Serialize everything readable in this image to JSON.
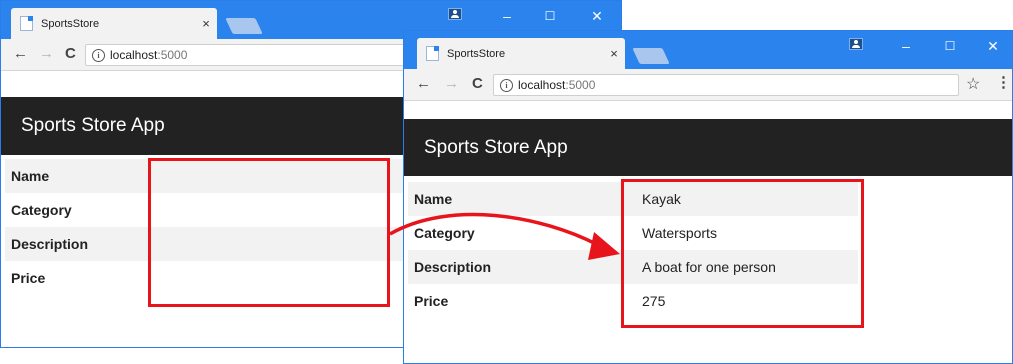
{
  "back_window": {
    "tab_title": "SportsStore",
    "tab_close": "×",
    "url_host": "localhost",
    "url_port": ":5000",
    "app_title": "Sports Store App",
    "rows": [
      {
        "label": "Name",
        "value": ""
      },
      {
        "label": "Category",
        "value": ""
      },
      {
        "label": "Description",
        "value": ""
      },
      {
        "label": "Price",
        "value": ""
      }
    ]
  },
  "front_window": {
    "tab_title": "SportsStore",
    "tab_close": "×",
    "url_host": "localhost",
    "url_port": ":5000",
    "app_title": "Sports Store App",
    "rows": [
      {
        "label": "Name",
        "value": "Kayak"
      },
      {
        "label": "Category",
        "value": "Watersports"
      },
      {
        "label": "Description",
        "value": "A boat for one person"
      },
      {
        "label": "Price",
        "value": "275"
      }
    ]
  },
  "glyphs": {
    "back": "←",
    "forward": "→",
    "reload": "C",
    "info": "i",
    "minimize": "–",
    "maximize": "☐",
    "close": "✕",
    "star": "☆",
    "menu": "⋮"
  },
  "icons": [
    "page-favicon-icon",
    "user-icon",
    "info-icon",
    "star-icon",
    "menu-icon"
  ],
  "colors": {
    "titlebar": "#2b84ee",
    "app_header": "#222222",
    "row_stripe": "#f2f2f2",
    "highlight": "#e8141b"
  }
}
